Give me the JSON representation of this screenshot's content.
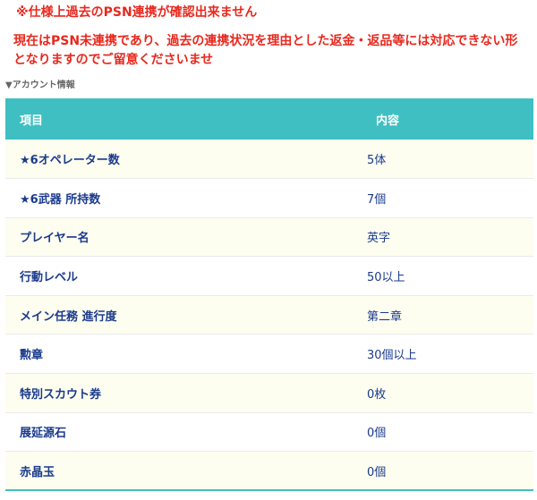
{
  "notice": {
    "line1": "※仕様上過去のPSN連携が確認出来ません",
    "body_line1": "現在はPSN未連携であり、過去の連携状況を理由とした返金・返品等には対応できない形",
    "body_line2": "となりますのでご留意くださいませ"
  },
  "section": {
    "label": "▼アカウント情報"
  },
  "table": {
    "header_item": "項目",
    "header_value": "内容",
    "rows": [
      {
        "item": "★6オペレーター数",
        "value": "5体"
      },
      {
        "item": "★6武器 所持数",
        "value": "7個"
      },
      {
        "item": "プレイヤー名",
        "value": "英字"
      },
      {
        "item": "行動レベル",
        "value": "50以上"
      },
      {
        "item": "メイン任務 進行度",
        "value": "第二章"
      },
      {
        "item": "勲章",
        "value": "30個以上"
      },
      {
        "item": "特別スカウト券",
        "value": "0枚"
      },
      {
        "item": "展延源石",
        "value": "0個"
      },
      {
        "item": "赤晶玉",
        "value": "0個"
      }
    ]
  },
  "colors": {
    "notice_red": "#e8281e",
    "header_teal": "#3fbfc2",
    "text_navy": "#1a3a8c",
    "row_alt": "#fdfdf0"
  }
}
